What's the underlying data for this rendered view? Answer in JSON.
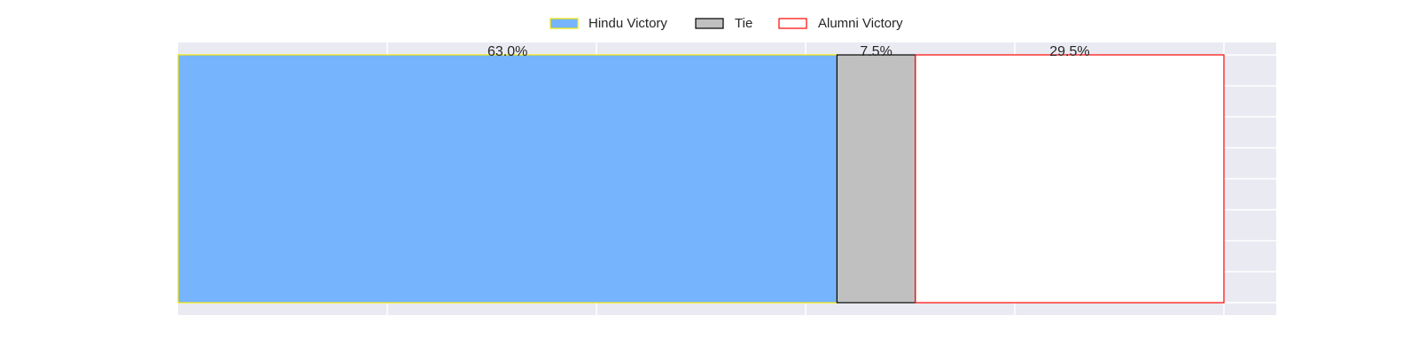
{
  "chart_data": {
    "type": "bar",
    "orientation": "horizontal-stacked",
    "xlim": [
      0,
      105
    ],
    "series": [
      {
        "name": "Hindu Victory",
        "value": 63.0,
        "label": "63.0%",
        "fill": "#76b4fd",
        "stroke": "#f2e600"
      },
      {
        "name": "Tie",
        "value": 7.5,
        "label": "7.5%",
        "fill": "#c0c0c0",
        "stroke": "#000000"
      },
      {
        "name": "Alumni Victory",
        "value": 29.5,
        "label": "29.5%",
        "fill": "#ffffff",
        "stroke": "#ff0000"
      }
    ],
    "grid": true,
    "legend": "top-center",
    "background": "#eaeaf2"
  }
}
